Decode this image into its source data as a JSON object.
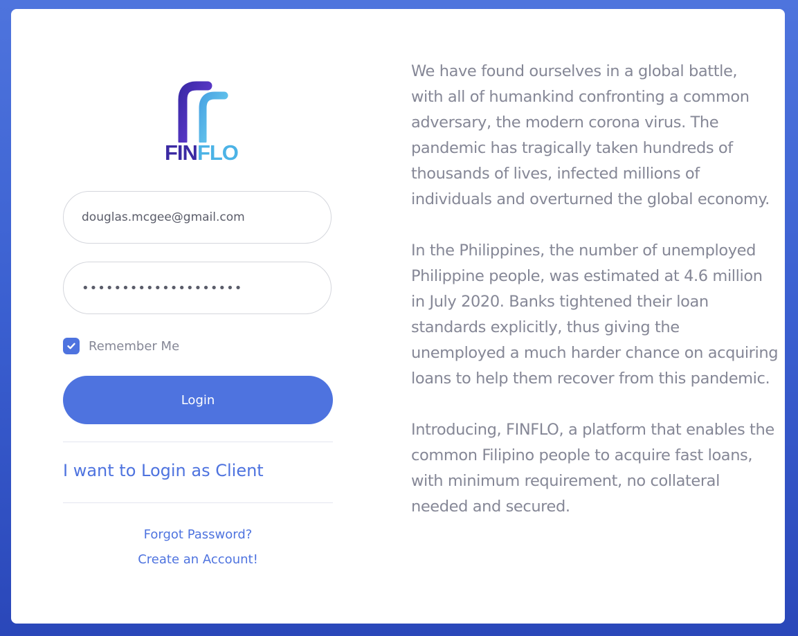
{
  "brand": {
    "name_part1": "FIN",
    "name_part2": "FLO",
    "colors": {
      "primary": "#4e73df",
      "logo_dark": "#3b2aa3",
      "logo_light": "#4cb3e6",
      "logo_purple": "#6a3ed6"
    }
  },
  "form": {
    "email_value": "douglas.mcgee@gmail.com",
    "password_value": "••••••••••••••••••••",
    "remember_label": "Remember Me",
    "remember_checked": true,
    "login_label": "Login",
    "client_link": "I want to Login as Client",
    "forgot_link": "Forgot Password?",
    "create_link": "Create an Account!"
  },
  "intro": {
    "paragraphs": [
      "We have found ourselves in a global battle,\nwith all of humankind confronting a common\nadversary, the modern corona virus. The\npandemic has tragically taken hundreds of\nthousands of lives, infected millions of\nindividuals and overturned the global economy.",
      "In the Philippines, the number of unemployed\nPhilippine people, was estimated at 4.6 million\nin July 2020. Banks tightened their loan\nstandards explicitly, thus giving the\nunemployed a much harder chance on acquiring\nloans to help them recover from this pandemic.",
      "Introducing, FINFLO, a platform that enables the\ncommon Filipino people to acquire fast loans,\nwith minimum requirement, no collateral\nneeded and secured."
    ]
  },
  "icons": {
    "logo": "finflo-logo-icon",
    "checkbox": "check-icon"
  }
}
